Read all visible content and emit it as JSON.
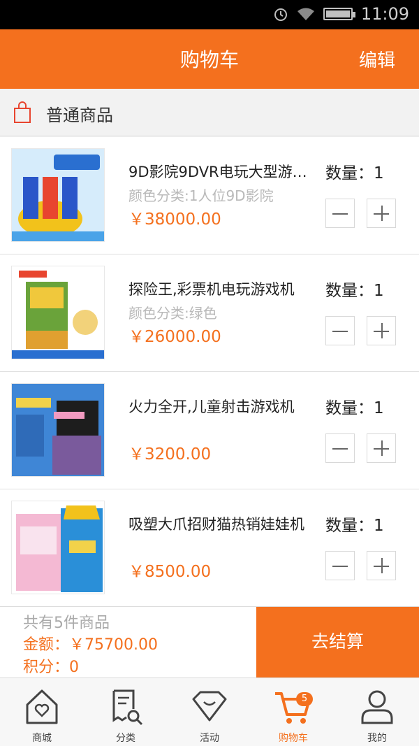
{
  "status_bar": {
    "time": "11:09"
  },
  "header": {
    "title": "购物车",
    "edit_label": "编辑"
  },
  "section": {
    "label": "普通商品"
  },
  "items": [
    {
      "name": "9D影院9DVR电玩大型游戏机",
      "spec": "颜色分类:1人位9D影院",
      "price": "￥38000.00",
      "qty": "数量：1"
    },
    {
      "name": "探险王,彩票机电玩游戏机",
      "spec": "颜色分类:绿色",
      "price": "￥26000.00",
      "qty": "数量：1"
    },
    {
      "name": "火力全开,儿童射击游戏机",
      "spec": "",
      "price": "￥3200.00",
      "qty": "数量：1"
    },
    {
      "name": "吸塑大爪招财猫热销娃娃机",
      "spec": "",
      "price": "￥8500.00",
      "qty": "数量：1"
    }
  ],
  "footer": {
    "count": "共有5件商品",
    "amount": "金额：￥75700.00",
    "points": "积分：0",
    "checkout_label": "去结算"
  },
  "tabbar": {
    "tabs": [
      {
        "label": "商城",
        "icon": "home-heart-icon"
      },
      {
        "label": "分类",
        "icon": "receipt-search-icon"
      },
      {
        "label": "活动",
        "icon": "diamond-icon"
      },
      {
        "label": "购物车",
        "icon": "cart-icon",
        "badge": "5"
      },
      {
        "label": "我的",
        "icon": "user-icon"
      }
    ]
  },
  "colors": {
    "accent": "#f4701e"
  }
}
